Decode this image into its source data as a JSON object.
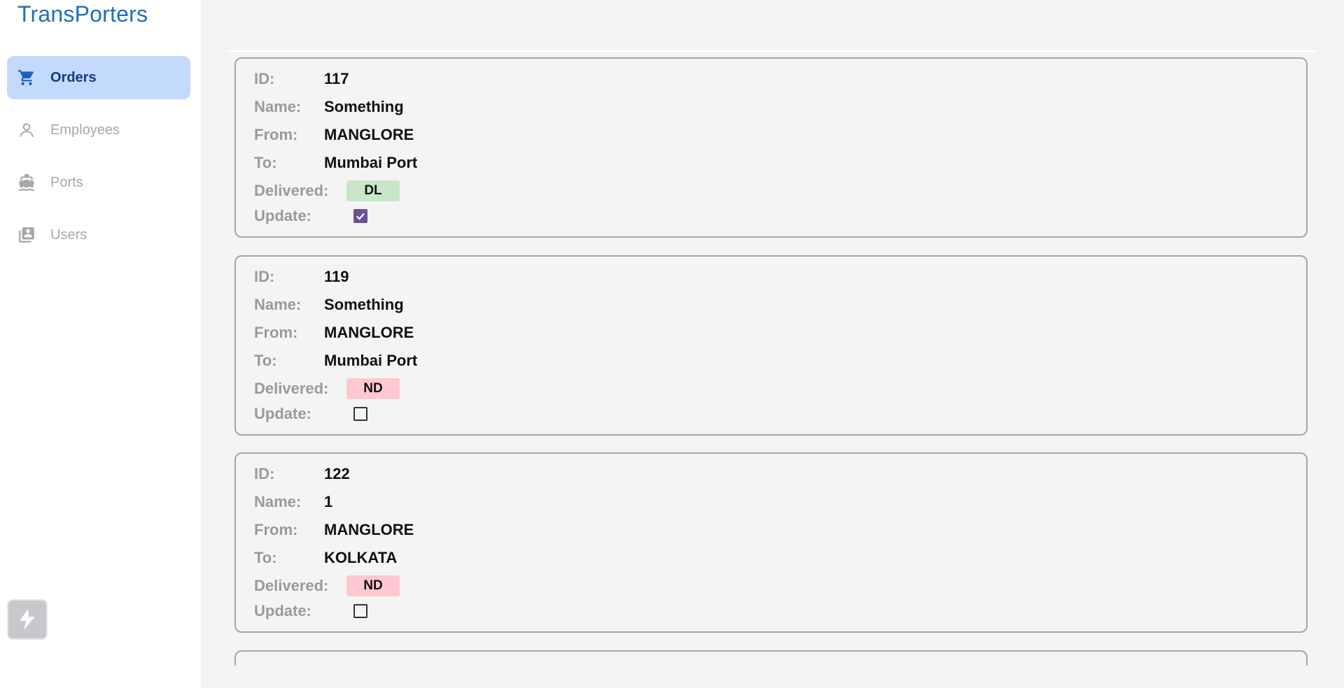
{
  "app": {
    "title": "TransPorters"
  },
  "sidebar": {
    "items": [
      {
        "label": "Orders",
        "icon": "cart-icon",
        "active": true
      },
      {
        "label": "Employees",
        "icon": "person-icon",
        "active": false
      },
      {
        "label": "Ports",
        "icon": "ship-icon",
        "active": false
      },
      {
        "label": "Users",
        "icon": "contacts-icon",
        "active": false
      }
    ],
    "bottom_icon": "stackblitz-logo"
  },
  "labels": {
    "id": "ID:",
    "name": "Name:",
    "from": "From:",
    "to": "To:",
    "delivered": "Delivered:",
    "update": "Update:"
  },
  "orders": [
    {
      "id": "117",
      "name": "Something",
      "from": "MANGLORE",
      "to": "Mumbai Port",
      "status": "DL",
      "checked": true
    },
    {
      "id": "119",
      "name": "Something",
      "from": "MANGLORE",
      "to": "Mumbai Port",
      "status": "ND",
      "checked": false
    },
    {
      "id": "122",
      "name": "1",
      "from": "MANGLORE",
      "to": "KOLKATA",
      "status": "ND",
      "checked": false
    }
  ],
  "colors": {
    "brand": "#1f6fbf",
    "active_nav_bg": "#c4dafc",
    "delivered_bg": "#c9e6c9",
    "not_delivered_bg": "#ffc7cf",
    "checkbox_checked": "#6a5294"
  }
}
